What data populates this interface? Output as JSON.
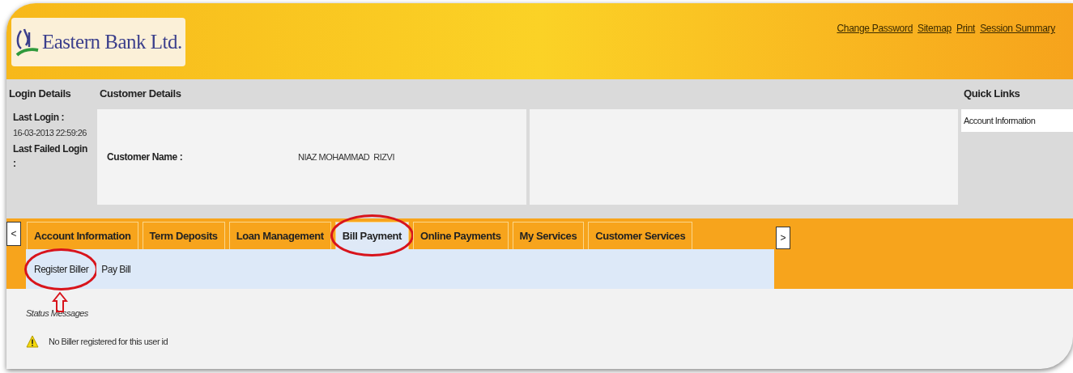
{
  "header": {
    "logo_text": "Eastern Bank Ltd.",
    "links": [
      "Change Password",
      "Sitemap",
      "Print",
      "Session Summary"
    ]
  },
  "login_details": {
    "title": "Login Details",
    "last_login_label": "Last Login :",
    "last_login_value": "16-03-2013 22:59:26",
    "last_failed_label": "Last Failed Login :"
  },
  "customer_details": {
    "title": "Customer Details",
    "name_label": "Customer Name :",
    "name_value": "NIAZ MOHAMMAD  RIZVI"
  },
  "quick_links": {
    "title": "Quick Links",
    "items": [
      "Account Information"
    ]
  },
  "nav": {
    "prev": "<",
    "next": ">",
    "tabs": [
      {
        "label": "Account Information",
        "selected": false,
        "annotated": false
      },
      {
        "label": "Term Deposits",
        "selected": false,
        "annotated": false
      },
      {
        "label": "Loan Management",
        "selected": false,
        "annotated": false
      },
      {
        "label": "Bill Payment",
        "selected": true,
        "annotated": true
      },
      {
        "label": "Online Payments",
        "selected": false,
        "annotated": false
      },
      {
        "label": "My Services",
        "selected": false,
        "annotated": false
      },
      {
        "label": "Customer Services",
        "selected": false,
        "annotated": false
      }
    ]
  },
  "subnav": [
    {
      "label": "Register Biller",
      "annotated": true,
      "arrow": true
    },
    {
      "label": "Pay Bill",
      "annotated": false,
      "arrow": false
    }
  ],
  "status": {
    "title": "Status Messages",
    "messages": [
      {
        "kind": "warning",
        "text": "No Biller registered for this user id"
      }
    ]
  }
}
